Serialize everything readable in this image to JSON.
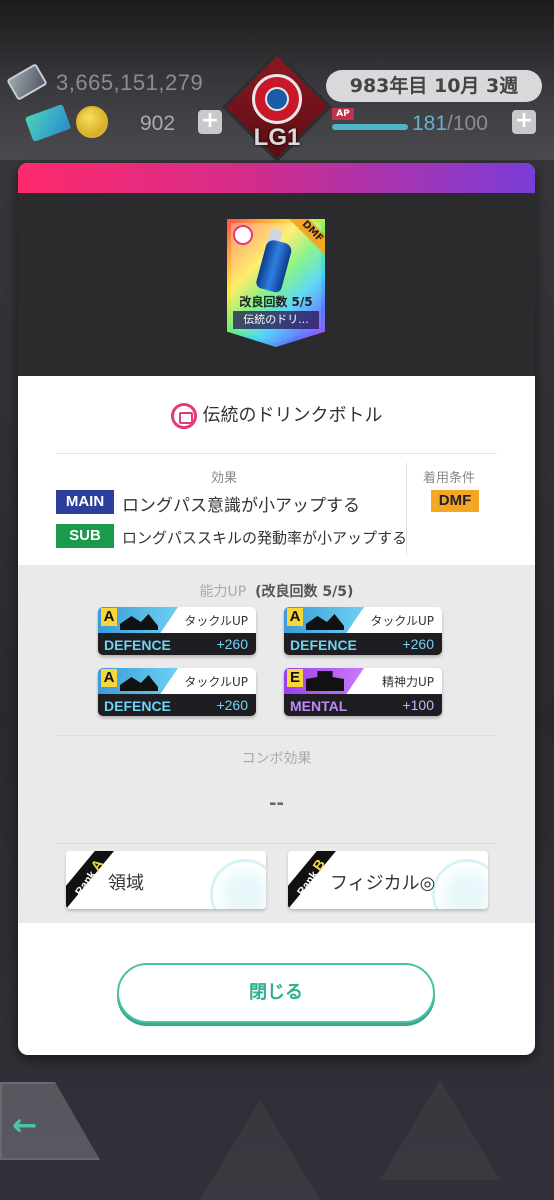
{
  "hud": {
    "money": "3,665,151,279",
    "coins": "902",
    "club_league": "LG1",
    "date": "983年目 10月 3週",
    "ap_label": "AP",
    "ap_current": "181",
    "ap_max": "/100",
    "ap_fraction": 1.0
  },
  "card": {
    "position": "DMF",
    "upgrade": "改良回数 5/5",
    "name_short": "伝統のドリ..."
  },
  "item": {
    "title": "伝統のドリンクボトル",
    "effect_label": "効果",
    "condition_label": "着用条件",
    "main_tag": "MAIN",
    "main_text": "ロングパス意識が小アップする",
    "sub_tag": "SUB",
    "sub_text": "ロングパススキルの発動率が小アップする",
    "condition": "DMF"
  },
  "ability": {
    "header": "能力UP",
    "header_detail": "(改良回数 5/5)",
    "cards": [
      {
        "grade": "A",
        "name": "タックルUP",
        "category": "DEFENCE",
        "value": "+260"
      },
      {
        "grade": "A",
        "name": "タックルUP",
        "category": "DEFENCE",
        "value": "+260"
      },
      {
        "grade": "A",
        "name": "タックルUP",
        "category": "DEFENCE",
        "value": "+260"
      },
      {
        "grade": "E",
        "name": "精神力UP",
        "category": "MENTAL",
        "value": "+100"
      }
    ]
  },
  "combo": {
    "label": "コンボ効果",
    "value": "--",
    "ranks": [
      {
        "rank_word": "Rank",
        "rank": "A",
        "label": "領域"
      },
      {
        "rank_word": "Rank",
        "rank": "B",
        "label": "フィジカル◎"
      }
    ]
  },
  "close_label": "閉じる",
  "back_icon": "←"
}
